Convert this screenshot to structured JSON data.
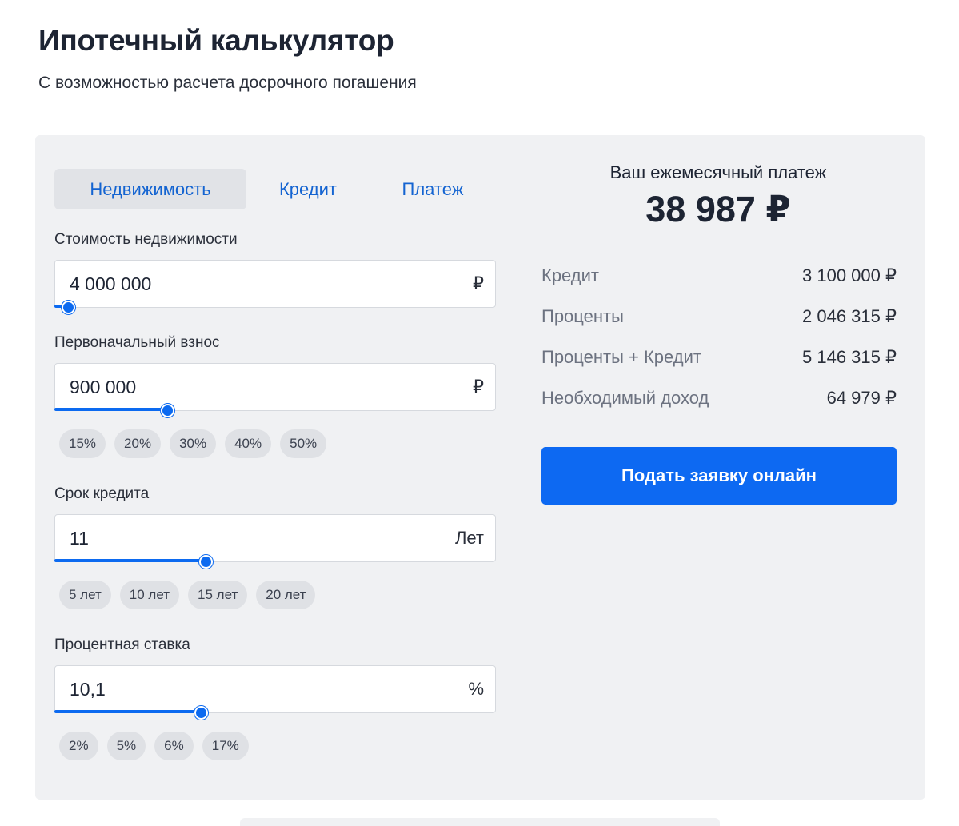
{
  "header": {
    "title": "Ипотечный калькулятор",
    "subtitle": "С возможностью расчета досрочного погашения"
  },
  "tabs": [
    {
      "label": "Недвижимость",
      "active": true
    },
    {
      "label": "Кредит",
      "active": false
    },
    {
      "label": "Платеж",
      "active": false
    }
  ],
  "fields": {
    "property_cost": {
      "label": "Стоимость недвижимости",
      "value": "4 000 000",
      "unit": "₽",
      "slider_fraction": 0.03
    },
    "down_payment": {
      "label": "Первоначальный взнос",
      "value": "900 000",
      "unit": "₽",
      "slider_fraction": 0.255,
      "chips": [
        "15%",
        "20%",
        "30%",
        "40%",
        "50%"
      ]
    },
    "loan_term": {
      "label": "Срок кредита",
      "value": "11",
      "unit": "Лет",
      "slider_fraction": 0.342,
      "chips": [
        "5 лет",
        "10 лет",
        "15 лет",
        "20 лет"
      ]
    },
    "interest_rate": {
      "label": "Процентная ставка",
      "value": "10,1",
      "unit": "%",
      "slider_fraction": 0.332,
      "chips": [
        "2%",
        "5%",
        "6%",
        "17%"
      ]
    }
  },
  "result": {
    "title": "Ваш ежемесячный платеж",
    "monthly_payment": "38 987 ₽",
    "rows": [
      {
        "label": "Кредит",
        "value": "3 100 000 ₽"
      },
      {
        "label": "Проценты",
        "value": "2 046 315 ₽"
      },
      {
        "label": "Проценты + Кредит",
        "value": "5 146 315 ₽"
      },
      {
        "label": "Необходимый доход",
        "value": "64 979 ₽"
      }
    ],
    "apply_label": "Подать заявку онлайн"
  },
  "colors": {
    "accent": "#0d69f2",
    "panel_bg": "#f0f1f3",
    "tab_text": "#1464d1"
  }
}
